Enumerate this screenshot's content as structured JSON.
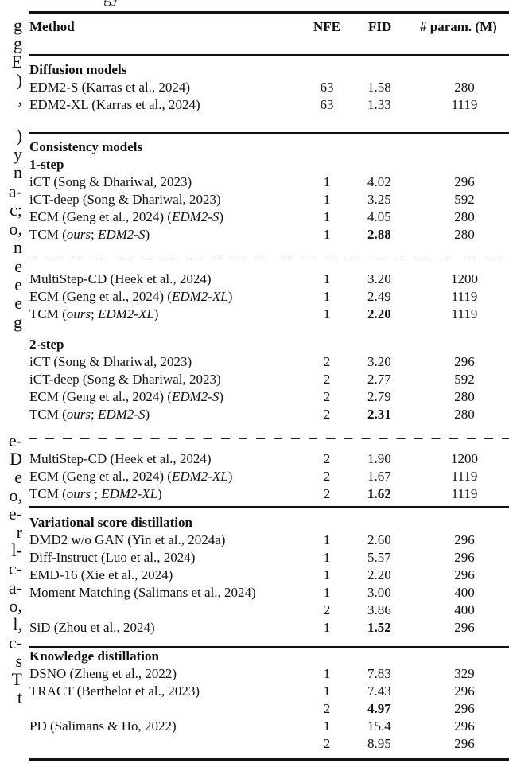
{
  "caption_fragment": "gy",
  "left_margin_fragments": [
    "g",
    "g",
    "E",
    ")",
    ",",
    ")",
    "y",
    "n",
    "a-",
    "c;",
    "o,",
    "n",
    "e",
    "e",
    "e",
    "g",
    "",
    "e-",
    "D",
    "e",
    "o,",
    "e-",
    "r",
    "l-",
    "c-",
    "a-",
    "o,",
    "l,",
    "c-",
    "s",
    "T",
    "t"
  ],
  "table": {
    "headers": {
      "method": "Method",
      "nfe": "NFE",
      "fid": "FID",
      "params": "# param. (M)"
    },
    "sections": [
      {
        "title": "Diffusion models",
        "rows": [
          {
            "method": "EDM2-S (Karras et al., 2024)",
            "nfe": "63",
            "fid": "1.58",
            "params": "280"
          },
          {
            "method": "EDM2-XL (Karras et al., 2024)",
            "nfe": "63",
            "fid": "1.33",
            "params": "1119"
          }
        ]
      },
      {
        "title": "Consistency models",
        "subsections": [
          {
            "title": "1-step",
            "rows": [
              {
                "method": "iCT (Song & Dhariwal, 2023)",
                "nfe": "1",
                "fid": "4.02",
                "params": "296"
              },
              {
                "method": "iCT-deep (Song & Dhariwal, 2023)",
                "nfe": "1",
                "fid": "3.25",
                "params": "592"
              },
              {
                "method_main": "ECM (Geng et al., 2024) (",
                "method_italic": "EDM2-S",
                "method_tail": ")",
                "nfe": "1",
                "fid": "4.05",
                "params": "280"
              },
              {
                "method_main": "TCM (",
                "method_italic": "ours",
                "method_mid": "; ",
                "method_italic2": "EDM2-S",
                "method_tail": ")",
                "nfe": "1",
                "fid": "2.88",
                "fid_bold": true,
                "params": "280"
              }
            ],
            "rows_after_dash": [
              {
                "method": "MultiStep-CD (Heek et al., 2024)",
                "nfe": "1",
                "fid": "3.20",
                "params": "1200"
              },
              {
                "method_main": "ECM (Geng et al., 2024) (",
                "method_italic": "EDM2-XL",
                "method_tail": ")",
                "nfe": "1",
                "fid": "2.49",
                "params": "1119"
              },
              {
                "method_main": "TCM (",
                "method_italic": "ours",
                "method_mid": "; ",
                "method_italic2": "EDM2-XL",
                "method_tail": ")",
                "nfe": "1",
                "fid": "2.20",
                "fid_bold": true,
                "params": "1119"
              }
            ]
          },
          {
            "title": "2-step",
            "rows": [
              {
                "method": "iCT (Song & Dhariwal, 2023)",
                "nfe": "2",
                "fid": "3.20",
                "params": "296"
              },
              {
                "method": "iCT-deep (Song & Dhariwal, 2023)",
                "nfe": "2",
                "fid": "2.77",
                "params": "592"
              },
              {
                "method_main": "ECM (Geng et al., 2024) (",
                "method_italic": "EDM2-S",
                "method_tail": ")",
                "nfe": "2",
                "fid": "2.79",
                "params": "280"
              },
              {
                "method_main": "TCM (",
                "method_italic": "ours",
                "method_mid": "; ",
                "method_italic2": "EDM2-S",
                "method_tail": ")",
                "nfe": "2",
                "fid": "2.31",
                "fid_bold": true,
                "params": "280"
              }
            ],
            "rows_after_dash": [
              {
                "method": "MultiStep-CD (Heek et al., 2024)",
                "nfe": "2",
                "fid": "1.90",
                "params": "1200"
              },
              {
                "method_main": "ECM (Geng et al., 2024) (",
                "method_italic": "EDM2-XL",
                "method_tail": ")",
                "nfe": "2",
                "fid": "1.67",
                "params": "1119"
              },
              {
                "method_main": "TCM (",
                "method_italic": "ours",
                "method_mid": " ; ",
                "method_italic2": "EDM2-XL",
                "method_tail": ")",
                "nfe": "2",
                "fid": "1.62",
                "fid_bold": true,
                "params": "1119"
              }
            ]
          }
        ]
      },
      {
        "title": "Variational score distillation",
        "rows": [
          {
            "method": "DMD2 w/o GAN (Yin et al., 2024a)",
            "nfe": "1",
            "fid": "2.60",
            "params": "296"
          },
          {
            "method": "Diff-Instruct (Luo et al., 2024)",
            "nfe": "1",
            "fid": "5.57",
            "params": "296"
          },
          {
            "method": "EMD-16 (Xie et al., 2024)",
            "nfe": "1",
            "fid": "2.20",
            "params": "296"
          },
          {
            "method": "Moment Matching (Salimans et al., 2024)",
            "nfe": "1",
            "fid": "3.00",
            "params": "400"
          },
          {
            "method": "",
            "nfe": "2",
            "fid": "3.86",
            "params": "400"
          },
          {
            "method": "SiD (Zhou et al., 2024)",
            "nfe": "1",
            "fid": "1.52",
            "fid_bold": true,
            "params": "296"
          }
        ]
      },
      {
        "title": "Knowledge distillation",
        "rows": [
          {
            "method": "DSNO (Zheng et al., 2022)",
            "nfe": "1",
            "fid": "7.83",
            "params": "329"
          },
          {
            "method": "TRACT (Berthelot et al., 2023)",
            "nfe": "1",
            "fid": "7.43",
            "params": "296"
          },
          {
            "method": "",
            "nfe": "2",
            "fid": "4.97",
            "fid_bold": true,
            "params": "296"
          },
          {
            "method": "PD (Salimans & Ho, 2022)",
            "nfe": "1",
            "fid": "15.4",
            "params": "296"
          },
          {
            "method": "",
            "nfe": "2",
            "fid": "8.95",
            "params": "296"
          }
        ]
      }
    ]
  }
}
